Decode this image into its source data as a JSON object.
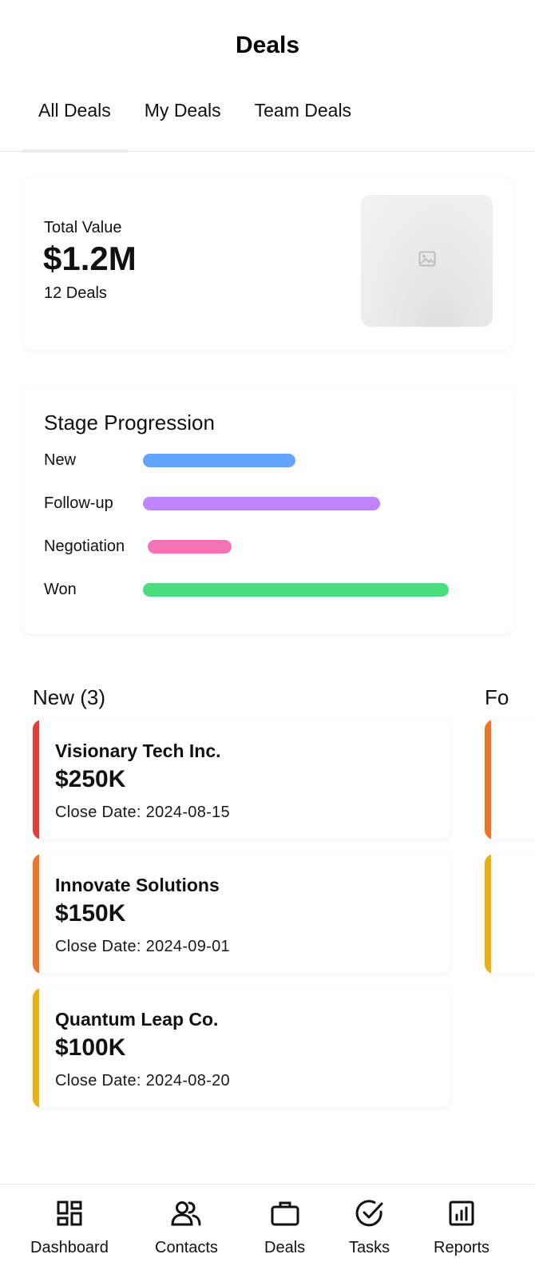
{
  "header": {
    "title": "Deals"
  },
  "tabs": [
    {
      "label": "All Deals",
      "active": true
    },
    {
      "label": "My Deals",
      "active": false
    },
    {
      "label": "Team Deals",
      "active": false
    }
  ],
  "summary": {
    "label": "Total Value",
    "value": "$1.2M",
    "count": "12 Deals",
    "image_icon": "image-icon"
  },
  "stage_progression": {
    "title": "Stage Progression",
    "stages": [
      {
        "label": "New",
        "color": "#60a5fa"
      },
      {
        "label": "Follow-up",
        "color": "#c084fc"
      },
      {
        "label": "Negotiation",
        "color": "#f472b6"
      },
      {
        "label": "Won",
        "color": "#4ade80"
      }
    ]
  },
  "columns": [
    {
      "title": "New (3)",
      "deals": [
        {
          "name": "Visionary Tech Inc.",
          "value": "$250K",
          "close_date": "Close Date: 2024-08-15",
          "accent": "#e23b3b"
        },
        {
          "name": "Innovate Solutions",
          "value": "$150K",
          "close_date": "Close Date: 2024-09-01",
          "accent": "#f07427"
        },
        {
          "name": "Quantum Leap Co.",
          "value": "$100K",
          "close_date": "Close Date: 2024-08-20",
          "accent": "#e8b112"
        }
      ]
    },
    {
      "title": "Fo",
      "deals": [
        {
          "accent": "#f07427"
        },
        {
          "accent": "#e8b112"
        }
      ]
    }
  ],
  "bottom_nav": [
    {
      "label": "Dashboard",
      "icon": "dashboard-icon"
    },
    {
      "label": "Contacts",
      "icon": "contacts-icon"
    },
    {
      "label": "Deals",
      "icon": "briefcase-icon"
    },
    {
      "label": "Tasks",
      "icon": "check-circle-icon"
    },
    {
      "label": "Reports",
      "icon": "reports-icon"
    }
  ]
}
